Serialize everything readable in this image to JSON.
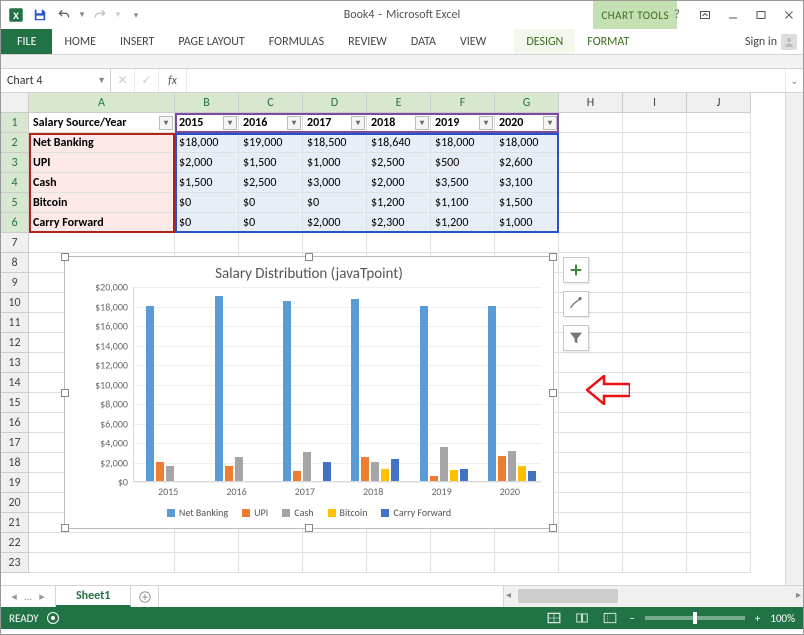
{
  "app": {
    "doc": "Book4",
    "name": "Microsoft Excel",
    "tools_context": "CHART TOOLS"
  },
  "ribbon": {
    "file": "FILE",
    "tabs": [
      "HOME",
      "INSERT",
      "PAGE LAYOUT",
      "FORMULAS",
      "REVIEW",
      "DATA",
      "VIEW"
    ],
    "tool_tabs": [
      "DESIGN",
      "FORMAT"
    ],
    "signin": "Sign in"
  },
  "namebox": "Chart 4",
  "fx": "fx",
  "cols": {
    "A_w": 146,
    "default_w": 64,
    "names": [
      "A",
      "B",
      "C",
      "D",
      "E",
      "F",
      "G",
      "H",
      "I",
      "J"
    ]
  },
  "header_row": [
    "Salary Source/Year",
    "2015",
    "2016",
    "2017",
    "2018",
    "2019",
    "2020"
  ],
  "rows": [
    {
      "label": "Net Banking",
      "vals": [
        "$18,000",
        "$19,000",
        "$18,500",
        "$18,640",
        "$18,000",
        "$18,000"
      ]
    },
    {
      "label": "UPI",
      "vals": [
        "$2,000",
        "$1,500",
        "$1,000",
        "$2,500",
        "$500",
        "$2,600"
      ]
    },
    {
      "label": "Cash",
      "vals": [
        "$1,500",
        "$2,500",
        "$3,000",
        "$2,000",
        "$3,500",
        "$3,100"
      ]
    },
    {
      "label": "Bitcoin",
      "vals": [
        "$0",
        "$0",
        "$0",
        "$1,200",
        "$1,100",
        "$1,500"
      ]
    },
    {
      "label": "Carry Forward",
      "vals": [
        "$0",
        "$0",
        "$2,000",
        "$2,300",
        "$1,200",
        "$1,000"
      ]
    }
  ],
  "sheet_tab": "Sheet1",
  "status": {
    "ready": "READY",
    "zoom": "100%"
  },
  "chart_data": {
    "type": "bar",
    "title": "Salary Distribution (javaTpoint)",
    "categories": [
      "2015",
      "2016",
      "2017",
      "2018",
      "2019",
      "2020"
    ],
    "series": [
      {
        "name": "Net Banking",
        "color": "#5b9bd5",
        "values": [
          18000,
          19000,
          18500,
          18640,
          18000,
          18000
        ]
      },
      {
        "name": "UPI",
        "color": "#ed7d31",
        "values": [
          2000,
          1500,
          1000,
          2500,
          500,
          2600
        ]
      },
      {
        "name": "Cash",
        "color": "#a5a5a5",
        "values": [
          1500,
          2500,
          3000,
          2000,
          3500,
          3100
        ]
      },
      {
        "name": "Bitcoin",
        "color": "#ffc000",
        "values": [
          0,
          0,
          0,
          1200,
          1100,
          1500
        ]
      },
      {
        "name": "Carry Forward",
        "color": "#4472c4",
        "values": [
          0,
          0,
          2000,
          2300,
          1200,
          1000
        ]
      }
    ],
    "ylim": [
      0,
      20000
    ],
    "yticks": [
      0,
      2000,
      4000,
      6000,
      8000,
      10000,
      12000,
      14000,
      16000,
      18000,
      20000
    ],
    "ytick_labels": [
      "$0",
      "$2,000",
      "$4,000",
      "$6,000",
      "$8,000",
      "$10,000",
      "$12,000",
      "$14,000",
      "$16,000",
      "$18,000",
      "$20,000"
    ]
  }
}
